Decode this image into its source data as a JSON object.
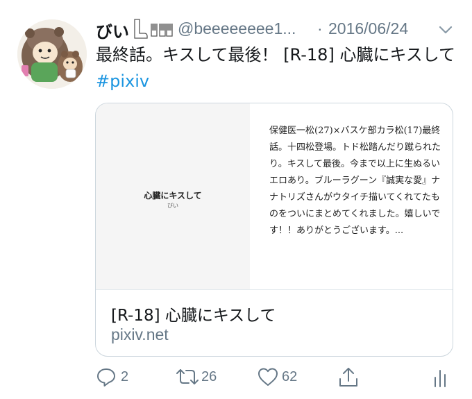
{
  "tweet": {
    "author_name": "びい",
    "author_handle": "@beeeeeeee1...",
    "separator": "·",
    "date": "2016/06/24",
    "text_main": "最終話。キスして最後！ [R-18] 心臓にキスして",
    "hashtag": "#pixiv"
  },
  "card": {
    "thumb_title": "心臓にキスして",
    "thumb_author": "びい",
    "description": "保健医一松(27)×バスケ部カラ松(17)最終話。十四松登場。トド松踏んだり蹴られたり。キスして最後。今まで以上に生ぬるいエロあり。ブルーラグーン『誠実な愛』ナナトリズさんがウタイチ描いてくれてたものをついにまとめてくれました。嬉しいです！！ありがとうございます。...",
    "title": "[R-18] 心臓にキスして",
    "domain": "pixiv.net"
  },
  "actions": {
    "reply_count": "2",
    "retweet_count": "26",
    "like_count": "62"
  },
  "icons": {
    "reply": "reply-icon",
    "retweet": "retweet-icon",
    "like": "heart-icon",
    "share": "share-icon",
    "analytics": "analytics-icon",
    "caret": "chevron-down-icon"
  },
  "colors": {
    "hashtag": "#1b95e0",
    "secondary": "#657786",
    "border": "#ccd6dd"
  }
}
